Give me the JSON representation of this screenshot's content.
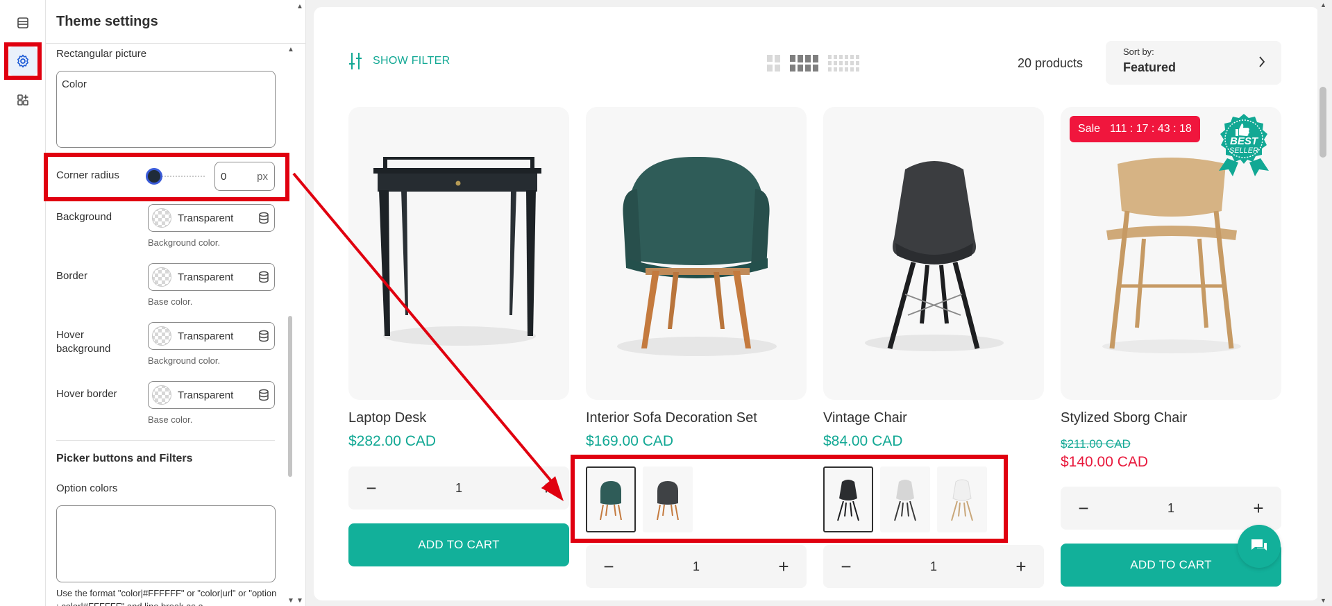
{
  "panel": {
    "title": "Theme settings",
    "rect_picture_label": "Rectangular picture",
    "rect_picture_value": "Color",
    "corner_radius_label": "Corner radius",
    "corner_radius_value": "0",
    "corner_radius_unit": "px",
    "background_label": "Background",
    "background_value": "Transparent",
    "background_help": "Background color.",
    "border_label": "Border",
    "border_value": "Transparent",
    "border_help": "Base color.",
    "hover_bg_label": "Hover background",
    "hover_bg_value": "Transparent",
    "hover_bg_help": "Background color.",
    "hover_border_label": "Hover border",
    "hover_border_value": "Transparent",
    "hover_border_help": "Base color.",
    "section_title": "Picker buttons and Filters",
    "option_colors_label": "Option colors",
    "option_colors_help": "Use the format \"color|#FFFFFF\" or \"color|url\" or \"option : color|#FFFFFF\" and line break as a"
  },
  "toolbar": {
    "show_filter": "SHOW FILTER",
    "count": "20 products",
    "sort_label": "Sort by:",
    "sort_value": "Featured"
  },
  "products": [
    {
      "title": "Laptop Desk",
      "price": "$282.00 CAD",
      "qty": "1",
      "cta": "ADD TO CART"
    },
    {
      "title": "Interior Sofa Decoration Set",
      "price": "$169.00 CAD",
      "qty": "1"
    },
    {
      "title": "Vintage Chair",
      "price": "$84.00 CAD",
      "qty": "1"
    },
    {
      "title": "Stylized Sborg Chair",
      "old_price": "$211.00 CAD",
      "price": "$140.00 CAD",
      "qty": "1",
      "cta": "ADD TO CART",
      "sale_label": "Sale",
      "countdown": "111 : 17 : 43 : 18",
      "badge_line1": "BEST",
      "badge_line2": "SELLER"
    }
  ],
  "colors": {
    "accent": "#12b09a",
    "sale": "#f0163d",
    "annotation": "#e0000f"
  }
}
